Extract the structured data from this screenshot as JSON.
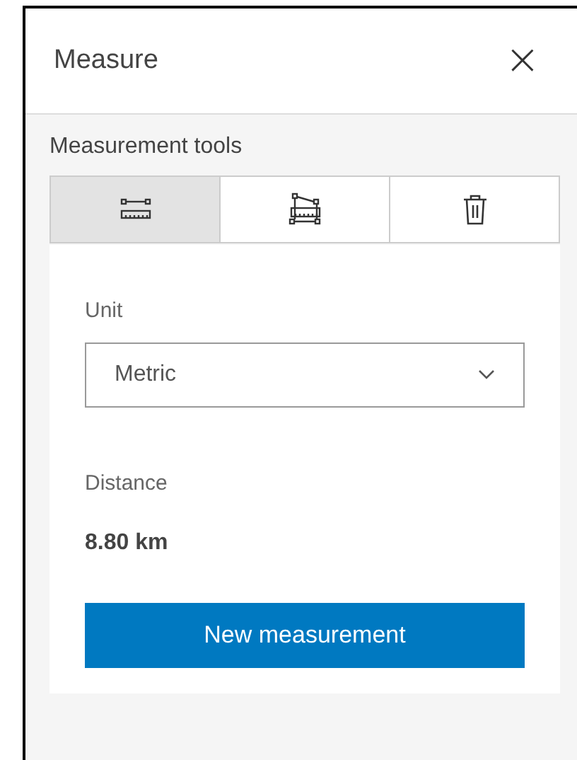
{
  "panel": {
    "title": "Measure",
    "close": "×"
  },
  "tools_label": "Measurement tools",
  "tools": [
    {
      "kind": "distance",
      "selected": true
    },
    {
      "kind": "area",
      "selected": false
    },
    {
      "kind": "clear",
      "selected": false
    }
  ],
  "unit": {
    "label": "Unit",
    "value": "Metric"
  },
  "result": {
    "label": "Distance",
    "value": "8.80 km"
  },
  "button": "New measurement"
}
